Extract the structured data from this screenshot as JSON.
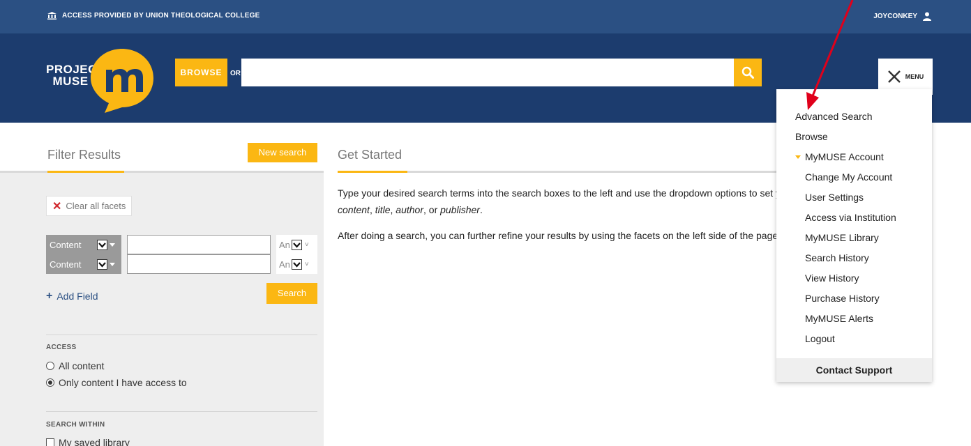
{
  "topbar": {
    "institution": "ACCESS PROVIDED BY UNION THEOLOGICAL COLLEGE",
    "username": "JOYCONKEY"
  },
  "header": {
    "logo_text_line1": "PROJECT",
    "logo_text_line2": "MUSE",
    "browse_label": "BROWSE",
    "or_label": "OR",
    "search_value": "",
    "menu_label": "MENU"
  },
  "filter": {
    "title": "Filter Results",
    "new_search_label": "New search",
    "clear_facets_label": "Clear all facets",
    "fields": [
      {
        "type": "Content",
        "bool": "An"
      },
      {
        "type": "Content",
        "bool": "An"
      }
    ],
    "add_field_label": "Add Field",
    "search_label": "Search",
    "access": {
      "label": "ACCESS",
      "options": [
        "All content",
        "Only content I have access to"
      ],
      "selected": 1
    },
    "search_within": {
      "label": "SEARCH WITHIN",
      "options": [
        "My saved library"
      ]
    }
  },
  "main": {
    "title": "Get Started",
    "para1_line1": "Type your desired search terms into the search boxes to the left and use the dropdown options to set yo",
    "para1_italic1": "content",
    "para1_italic2": "title",
    "para1_italic3": "author",
    "para1_or": "or",
    "para1_italic4": "publisher",
    "para2": "After doing a search, you can further refine your results by using the facets on the left side of the page."
  },
  "menu": {
    "items": [
      "Advanced Search",
      "Browse"
    ],
    "account_label": "MyMUSE Account",
    "account_items": [
      "Change My Account",
      "User Settings",
      "Access via Institution",
      "MyMUSE Library",
      "Search History",
      "View History",
      "Purchase History",
      "MyMUSE Alerts",
      "Logout"
    ],
    "contact_label": "Contact Support"
  },
  "colors": {
    "topbar": "#2b5083",
    "header": "#1c3c6e",
    "accent": "#fbb713",
    "close_x": "#d0282e",
    "annotation_arrow": "#e0001b"
  }
}
